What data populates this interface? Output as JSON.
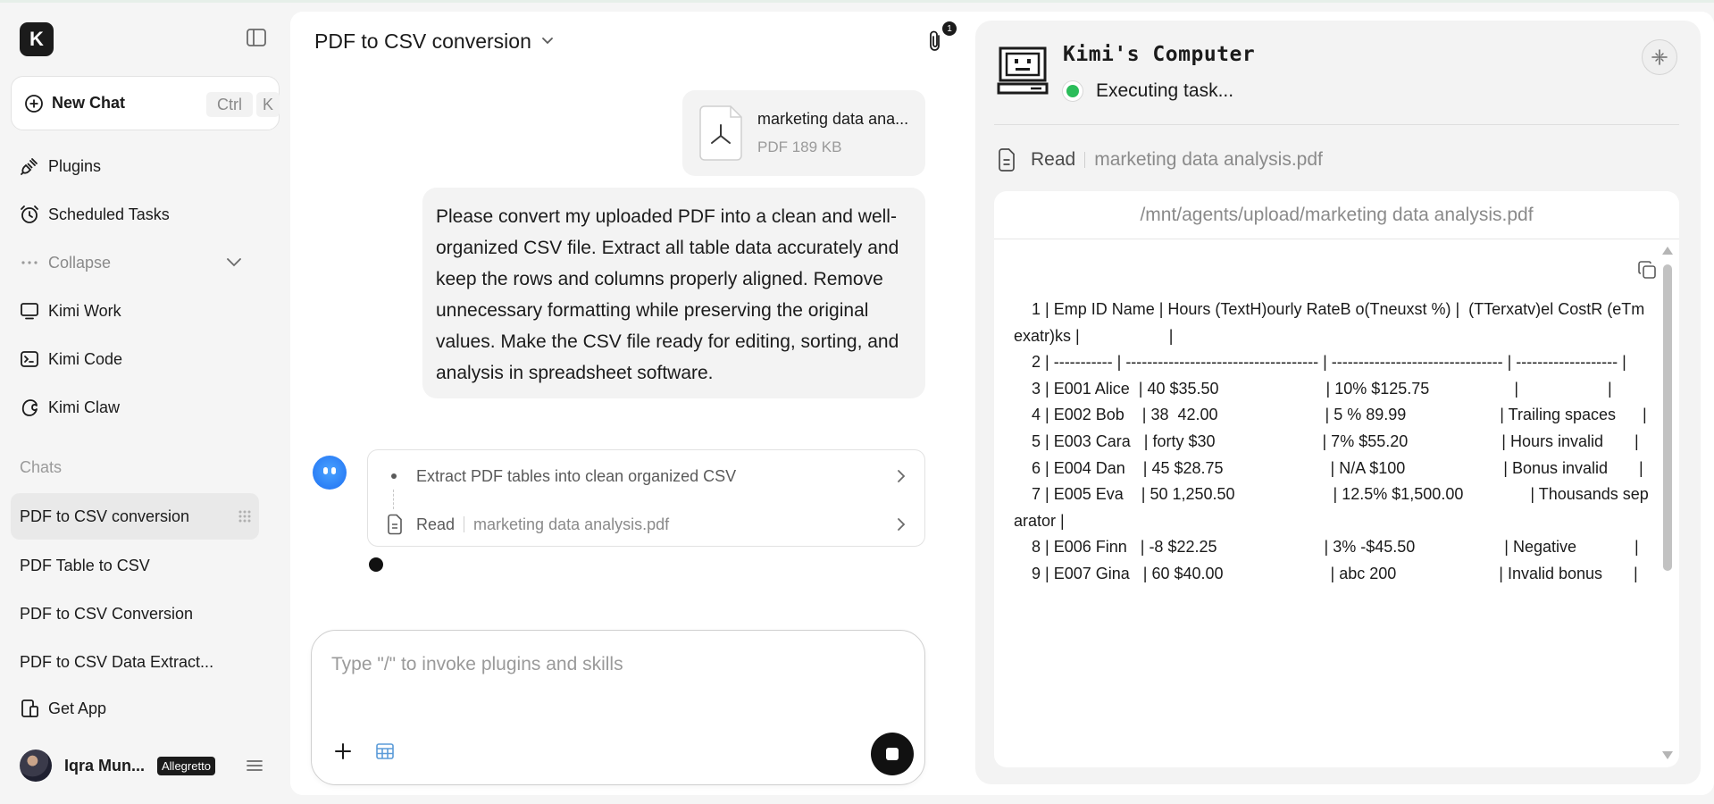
{
  "sidebar": {
    "logo_letter": "K",
    "new_chat": {
      "label": "New Chat",
      "shortcut_ctrl": "Ctrl",
      "shortcut_key": "K"
    },
    "nav": [
      {
        "label": "Plugins",
        "icon": "plug-icon"
      },
      {
        "label": "Scheduled Tasks",
        "icon": "alarm-clock-icon"
      },
      {
        "label": "Collapse",
        "icon": "ellipsis-icon"
      },
      {
        "label": "Kimi Work",
        "icon": "monitor-icon"
      },
      {
        "label": "Kimi Code",
        "icon": "terminal-icon"
      },
      {
        "label": "Kimi Claw",
        "icon": "claw-icon"
      }
    ],
    "chats_label": "Chats",
    "chats": [
      {
        "label": "PDF to CSV conversion",
        "active": true
      },
      {
        "label": "PDF Table to CSV"
      },
      {
        "label": "PDF to CSV Conversion"
      },
      {
        "label": "PDF to CSV Data Extract..."
      }
    ],
    "get_app": "Get App",
    "user": {
      "name": "Iqra Mun...",
      "badge": "Allegretto"
    }
  },
  "chat": {
    "title": "PDF to CSV conversion",
    "attachment_count": "1",
    "file": {
      "name": "marketing data ana...",
      "meta": "PDF 189 KB"
    },
    "user_message": "Please convert my uploaded PDF into a clean and well-organized CSV file. Extract all table data accurately and keep the rows and columns properly aligned. Remove unnecessary formatting while preserving the original values. Make the CSV file ready for editing, sorting, and analysis in spreadsheet software.",
    "steps": {
      "task": "Extract PDF tables into clean organized CSV",
      "read_op": "Read",
      "read_file": "marketing data analysis.pdf"
    },
    "composer_placeholder": "Type \"/\" to invoke plugins and skills"
  },
  "panel": {
    "title": "Kimi's Computer",
    "status": "Executing task...",
    "read_op": "Read",
    "read_file": "marketing data analysis.pdf",
    "path": "/mnt/agents/upload/marketing data analysis.pdf",
    "lines": [
      "    1 | Emp ID Name | Hours (TextH)ourly RateB o(Tneuxst %) |  (TTerxatv)el CostR (eTmexatr)ks |                    |",
      "    2 | ----------- | ------------------------------------ | -------------------------------- | ------------------- |",
      "    3 | E001 Alice  | 40 $35.50                        | 10% $125.75                   |                    |",
      "    4 | E002 Bob    | 38  42.00                        | 5 % 89.99                     | Trailing spaces      |",
      "    5 | E003 Cara   | forty $30                        | 7% $55.20                     | Hours invalid       |",
      "    6 | E004 Dan    | 45 $28.75                        | N/A $100                      | Bonus invalid       |",
      "    7 | E005 Eva    | 50 1,250.50                      | 12.5% $1,500.00               | Thousands separator |",
      "    8 | E006 Finn   | -8 $22.25                        | 3% -$45.50                    | Negative             |",
      "    9 | E007 Gina   | 60 $40.00                        | abc 200                       | Invalid bonus       |"
    ]
  }
}
